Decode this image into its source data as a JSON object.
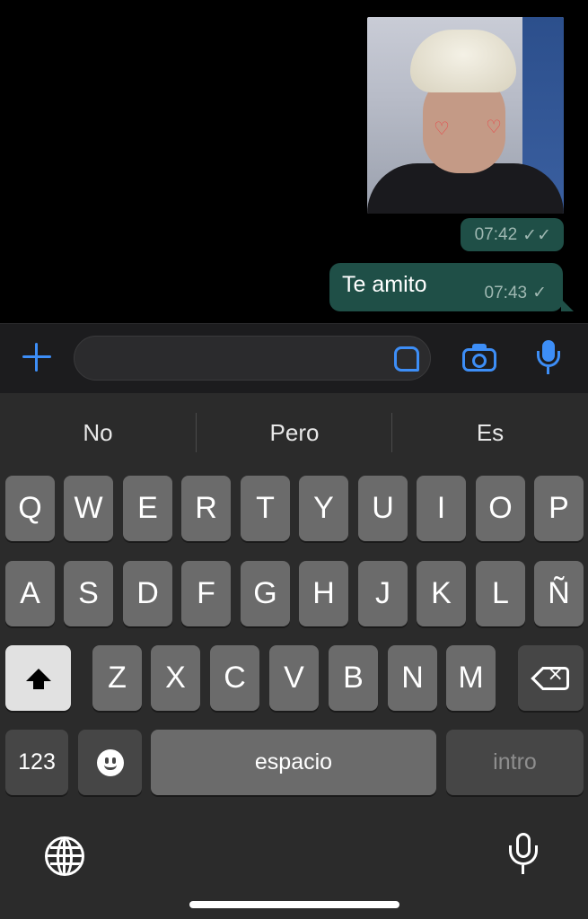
{
  "chat": {
    "photo_time": "07:42",
    "message_text": "Te amito",
    "message_time": "07:43",
    "read_check": "✓✓",
    "sent_check": "✓"
  },
  "input": {
    "placeholder": ""
  },
  "keyboard": {
    "suggestions": [
      "No",
      "Pero",
      "Es"
    ],
    "row1": [
      "Q",
      "W",
      "E",
      "R",
      "T",
      "Y",
      "U",
      "I",
      "O",
      "P"
    ],
    "row2": [
      "A",
      "S",
      "D",
      "F",
      "G",
      "H",
      "J",
      "K",
      "L",
      "Ñ"
    ],
    "row3": [
      "Z",
      "X",
      "C",
      "V",
      "B",
      "N",
      "M"
    ],
    "numbers_key": "123",
    "space_key": "espacio",
    "return_key": "intro"
  },
  "colors": {
    "accent": "#3d8ef7",
    "bubble": "#1f4f47",
    "key": "#6b6b6b",
    "keyboard_bg": "#2b2b2b"
  }
}
